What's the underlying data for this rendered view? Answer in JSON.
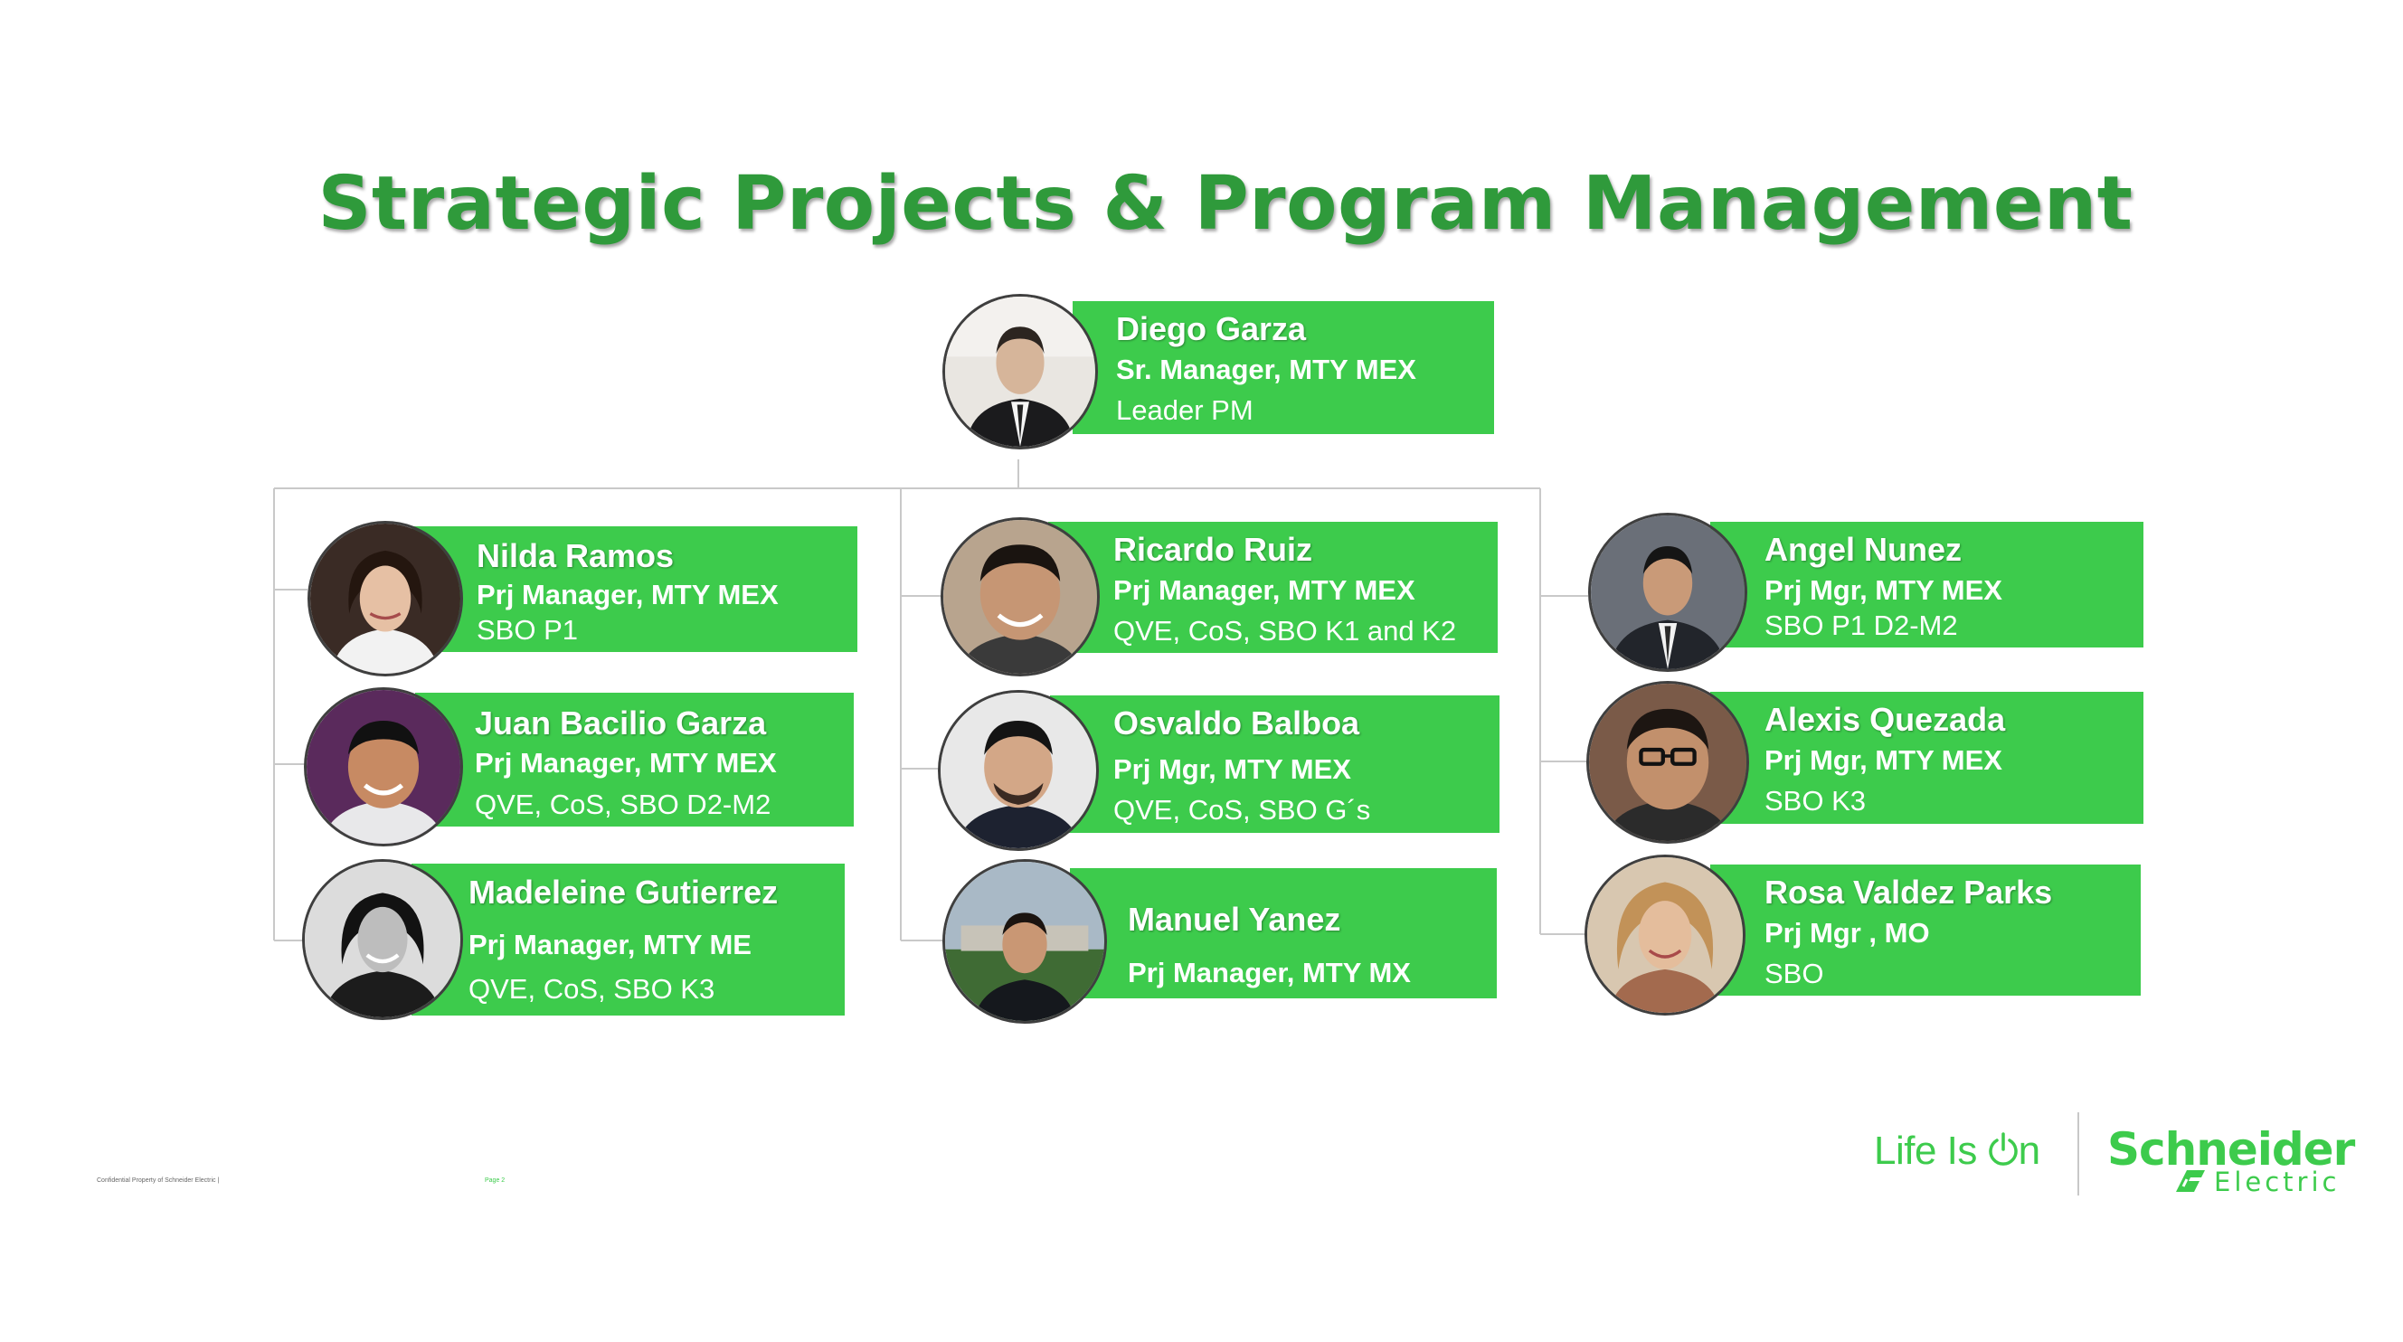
{
  "title": "Strategic Projects & Program Management",
  "leader": {
    "name": "Diego Garza",
    "role": "Sr. Manager, MTY MEX",
    "scope": "Leader PM"
  },
  "columns": [
    [
      {
        "name": "Nilda Ramos",
        "role": "Prj Manager, MTY MEX",
        "scope": "SBO P1"
      },
      {
        "name": "Juan Bacilio Garza",
        "role": "Prj Manager,  MTY MEX",
        "scope": "QVE, CoS, SBO D2-M2"
      },
      {
        "name": "Madeleine Gutierrez",
        "role": "Prj Manager,  MTY ME",
        "scope": "QVE, CoS, SBO K3"
      }
    ],
    [
      {
        "name": "Ricardo Ruiz",
        "role": "Prj Manager,  MTY MEX",
        "scope": "QVE, CoS, SBO K1 and K2"
      },
      {
        "name": "Osvaldo Balboa",
        "role": "Prj Mgr, MTY MEX",
        "scope": "QVE, CoS, SBO G´s"
      },
      {
        "name": "Manuel Yanez",
        "role": "Prj Manager, MTY MX",
        "scope": ""
      }
    ],
    [
      {
        "name": "Angel Nunez",
        "role": "Prj Mgr, MTY MEX",
        "scope": "SBO P1 D2-M2"
      },
      {
        "name": "Alexis Quezada",
        "role": "Prj Mgr, MTY MEX",
        "scope": "SBO K3"
      },
      {
        "name": "Rosa Valdez Parks",
        "role": "Prj Mgr , MO",
        "scope": "SBO"
      }
    ]
  ],
  "footer": {
    "confidential": "Confidential Property of Schneider Electric |",
    "page": "Page 2",
    "tagline_before_icon": "Life Is ",
    "tagline_after_icon": "n",
    "brand_line1": "Schneider",
    "brand_line2": "Electric"
  },
  "colors": {
    "title": "#2f9a3b",
    "card": "#3dcb4c",
    "text_on_card": "#ffffff",
    "connector": "#c9c9c9"
  },
  "icons": [
    "power-icon",
    "schneider-logo-icon"
  ]
}
